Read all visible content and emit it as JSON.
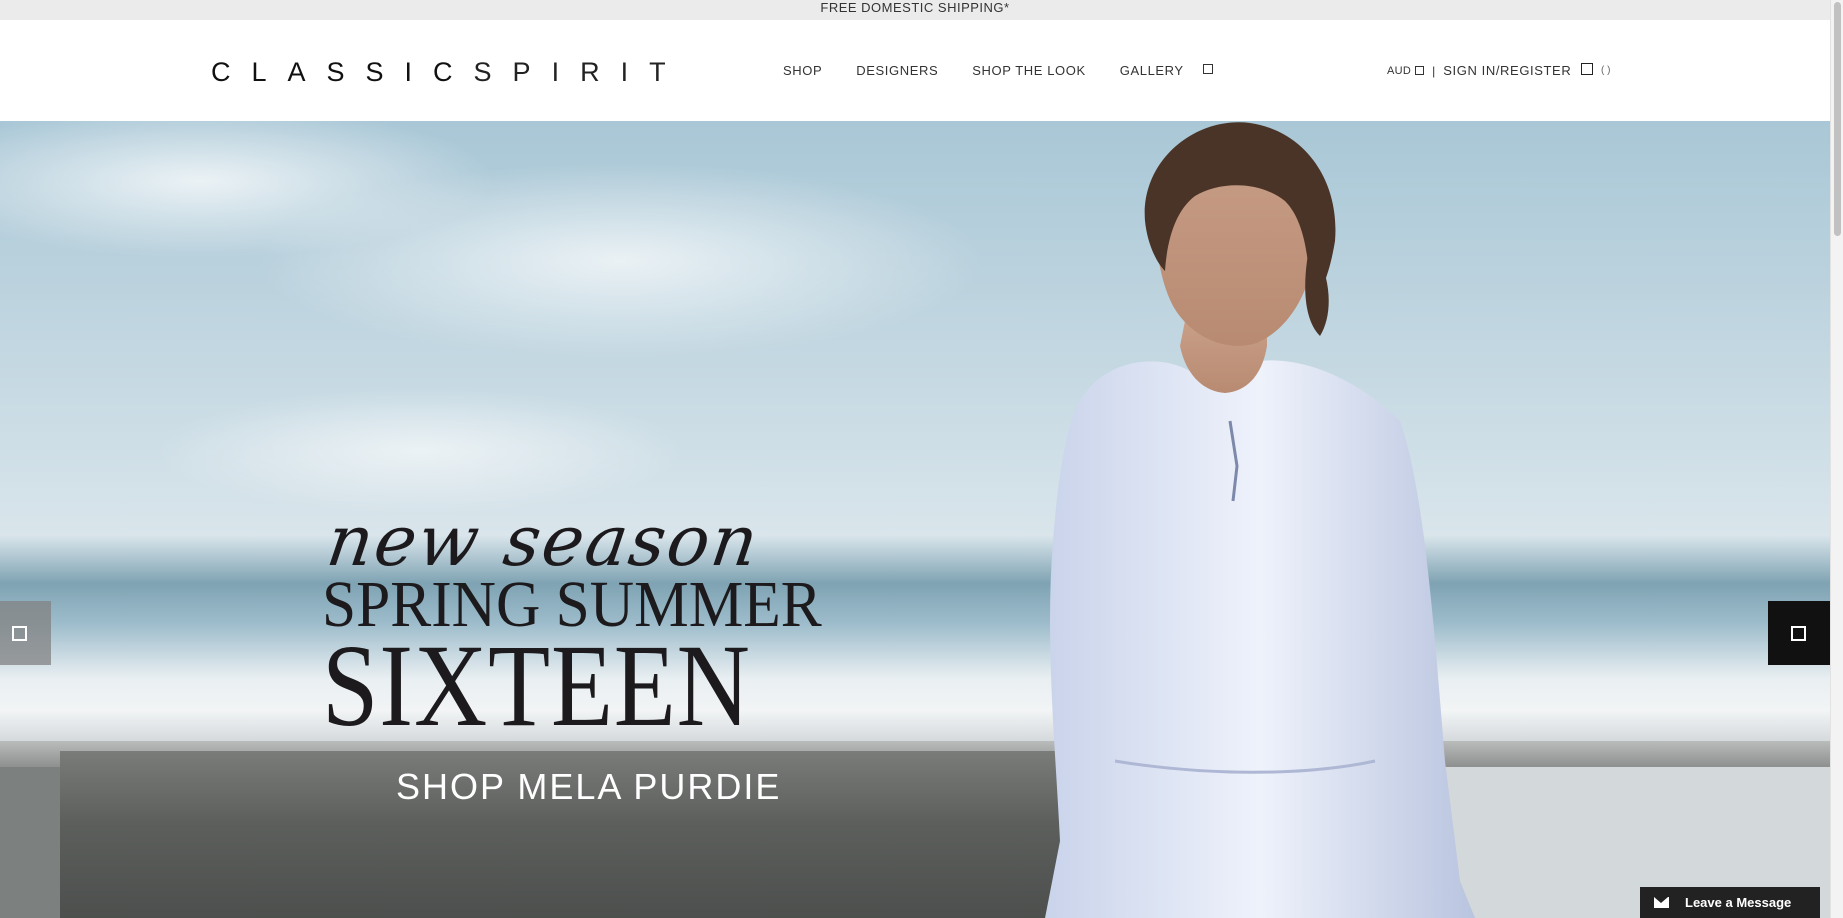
{
  "topbar": {
    "text": "FREE DOMESTIC SHIPPING*"
  },
  "logo": {
    "part1": "CLASSIC",
    "part2": "SPIRIT"
  },
  "nav": {
    "items": [
      {
        "label": "SHOP"
      },
      {
        "label": "DESIGNERS"
      },
      {
        "label": "SHOP THE LOOK"
      },
      {
        "label": "GALLERY"
      }
    ],
    "search_icon": "search-icon"
  },
  "utility": {
    "currency": "AUD",
    "separator": "|",
    "signin": "SIGN IN/REGISTER",
    "cart_icon": "shopping-bag-icon",
    "cart_count": "( )"
  },
  "hero": {
    "script_line": "new season",
    "line2": "SPRING SUMMER",
    "line3": "SIXTEEN",
    "cta": "SHOP MELA PURDIE",
    "prev_icon": "chevron-left-icon",
    "next_icon": "chevron-right-icon"
  },
  "chat": {
    "label": "Leave a Message",
    "icon": "envelope-icon"
  },
  "colors": {
    "topbar_bg": "#ebebeb",
    "text": "#222222",
    "chat_bg": "#222222",
    "arrow_right_bg": "#111111"
  }
}
